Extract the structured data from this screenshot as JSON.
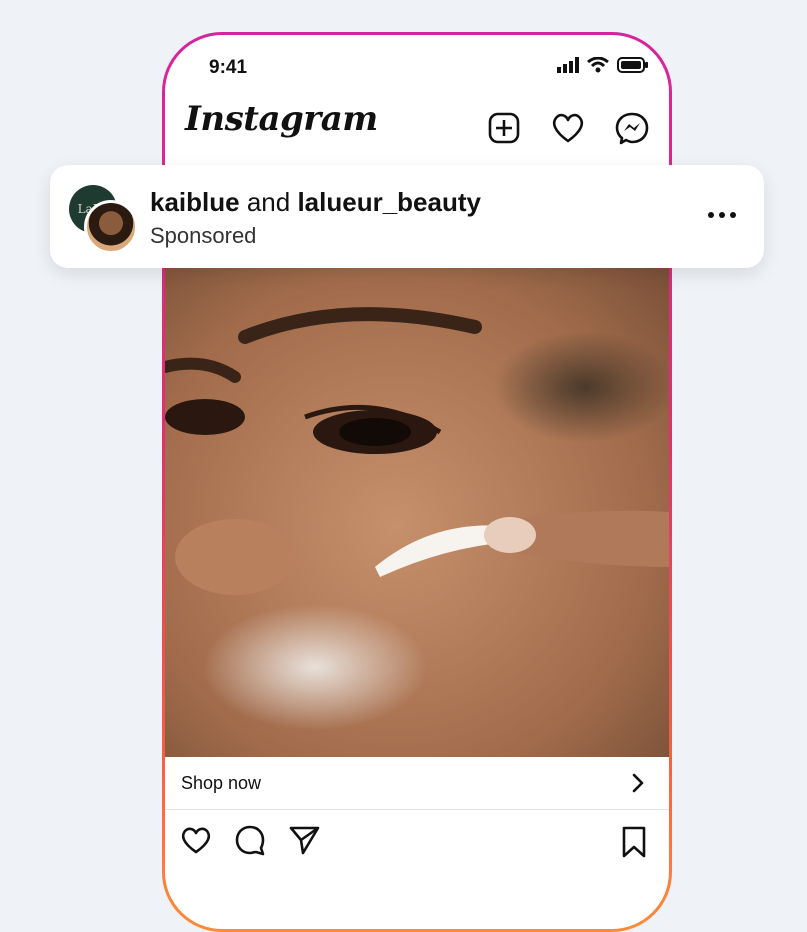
{
  "status_bar": {
    "time": "9:41",
    "icons": [
      "signal-icon",
      "wifi-icon",
      "battery-icon"
    ]
  },
  "header": {
    "app_title": "Instagram",
    "icons": [
      "new-post-icon",
      "heart-icon",
      "messenger-icon"
    ]
  },
  "post": {
    "account_1": "kaiblue",
    "connector": "and",
    "account_2": "lalueur_beauty",
    "label": "Sponsored",
    "brand_avatar_text": "LaLu",
    "more_icon": "more-icon",
    "image_description_icon": "post-image"
  },
  "shop": {
    "label": "Shop now",
    "icon": "chevron-right-icon"
  },
  "actions": [
    "like-icon",
    "comment-icon",
    "share-icon",
    "bookmark-icon"
  ],
  "colors": {
    "frame_gradient_top": "#d6249f",
    "frame_gradient_bottom": "#fd8c3a",
    "background": "#eff2f7"
  }
}
